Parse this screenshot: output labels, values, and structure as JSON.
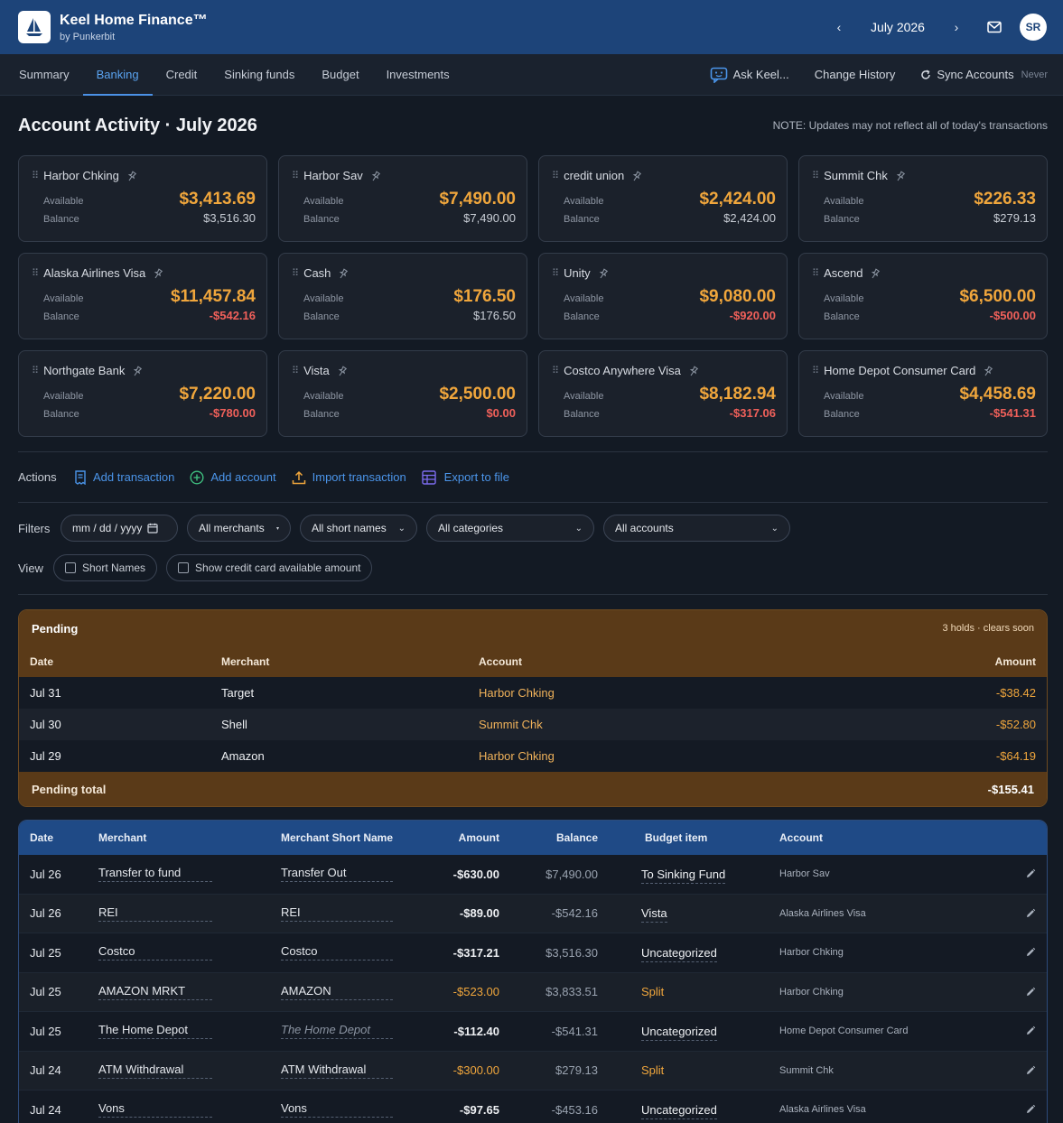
{
  "header": {
    "title": "Keel Home Finance™",
    "subtitle": "by Punkerbit",
    "month": "July 2026",
    "prev": "‹",
    "next": "›",
    "avatar": "SR"
  },
  "nav": {
    "tabs": [
      "Summary",
      "Banking",
      "Credit",
      "Sinking funds",
      "Budget",
      "Investments"
    ],
    "active": "Banking",
    "ask": "Ask Keel...",
    "history": "Change History",
    "sync": "Sync Accounts",
    "sync_status": "Never"
  },
  "page": {
    "title": "Account Activity · July 2026",
    "note": "NOTE: Updates may not reflect all of today's transactions"
  },
  "labels": {
    "available": "Available",
    "balance": "Balance"
  },
  "accounts": [
    {
      "name": "Harbor Chking",
      "available": "$3,413.69",
      "balance": "$3,516.30",
      "negative": false
    },
    {
      "name": "Harbor Sav",
      "available": "$7,490.00",
      "balance": "$7,490.00",
      "negative": false
    },
    {
      "name": "credit union",
      "available": "$2,424.00",
      "balance": "$2,424.00",
      "negative": false
    },
    {
      "name": "Summit Chk",
      "available": "$226.33",
      "balance": "$279.13",
      "negative": false
    },
    {
      "name": "Alaska Airlines Visa",
      "available": "$11,457.84",
      "balance": "-$542.16",
      "negative": true
    },
    {
      "name": "Cash",
      "available": "$176.50",
      "balance": "$176.50",
      "negative": false
    },
    {
      "name": "Unity",
      "available": "$9,080.00",
      "balance": "-$920.00",
      "negative": true
    },
    {
      "name": "Ascend",
      "available": "$6,500.00",
      "balance": "-$500.00",
      "negative": true
    },
    {
      "name": "Northgate Bank",
      "available": "$7,220.00",
      "balance": "-$780.00",
      "negative": true
    },
    {
      "name": "Vista",
      "available": "$2,500.00",
      "balance": "$0.00",
      "negative": true
    },
    {
      "name": "Costco Anywhere Visa",
      "available": "$8,182.94",
      "balance": "-$317.06",
      "negative": true
    },
    {
      "name": "Home Depot Consumer Card",
      "available": "$4,458.69",
      "balance": "-$541.31",
      "negative": true
    }
  ],
  "actions": {
    "label": "Actions",
    "add_transaction": "Add transaction",
    "add_account": "Add account",
    "import_transaction": "Import transaction",
    "export": "Export to file"
  },
  "filters": {
    "label": "Filters",
    "date_placeholder": "mm / dd / yyyy",
    "merchants": "All merchants",
    "short_names": "All short names",
    "categories": "All categories",
    "accounts": "All accounts"
  },
  "view": {
    "label": "View",
    "short_names": "Short Names",
    "show_cc": "Show credit card available amount"
  },
  "pending": {
    "title": "Pending",
    "subtitle": "3 holds · clears soon",
    "columns": [
      "Date",
      "Merchant",
      "Account",
      "Amount"
    ],
    "rows": [
      {
        "date": "Jul 31",
        "merchant": "Target",
        "account": "Harbor Chking",
        "amount": "-$38.42"
      },
      {
        "date": "Jul 30",
        "merchant": "Shell",
        "account": "Summit Chk",
        "amount": "-$52.80"
      },
      {
        "date": "Jul 29",
        "merchant": "Amazon",
        "account": "Harbor Chking",
        "amount": "-$64.19"
      }
    ],
    "total_label": "Pending total",
    "total": "-$155.41"
  },
  "transactions": {
    "columns": [
      "Date",
      "Merchant",
      "Merchant Short Name",
      "Amount",
      "Balance",
      "Budget item",
      "Account"
    ],
    "rows": [
      {
        "date": "Jul 26",
        "merchant": "Transfer to fund",
        "short": "Transfer Out",
        "amount": "-$630.00",
        "balance": "$7,490.00",
        "budget": "To Sinking Fund",
        "account": "Harbor Sav",
        "split": false,
        "italic": false
      },
      {
        "date": "Jul 26",
        "merchant": "REI",
        "short": "REI",
        "amount": "-$89.00",
        "balance": "-$542.16",
        "budget": "Vista",
        "account": "Alaska Airlines Visa",
        "split": false,
        "italic": false
      },
      {
        "date": "Jul 25",
        "merchant": "Costco",
        "short": "Costco",
        "amount": "-$317.21",
        "balance": "$3,516.30",
        "budget": "Uncategorized",
        "account": "Harbor Chking",
        "split": false,
        "italic": false
      },
      {
        "date": "Jul 25",
        "merchant": "AMAZON MRKT",
        "short": "AMAZON",
        "amount": "-$523.00",
        "balance": "$3,833.51",
        "budget": "Split",
        "account": "Harbor Chking",
        "split": true,
        "italic": false
      },
      {
        "date": "Jul 25",
        "merchant": "The Home Depot",
        "short": "The Home Depot",
        "amount": "-$112.40",
        "balance": "-$541.31",
        "budget": "Uncategorized",
        "account": "Home Depot Consumer Card",
        "split": false,
        "italic": true
      },
      {
        "date": "Jul 24",
        "merchant": "ATM Withdrawal",
        "short": "ATM Withdrawal",
        "amount": "-$300.00",
        "balance": "$279.13",
        "budget": "Split",
        "account": "Summit Chk",
        "split": true,
        "italic": false
      },
      {
        "date": "Jul 24",
        "merchant": "Vons",
        "short": "Vons",
        "amount": "-$97.65",
        "balance": "-$453.16",
        "budget": "Uncategorized",
        "account": "Alaska Airlines Visa",
        "split": false,
        "italic": false
      }
    ]
  }
}
